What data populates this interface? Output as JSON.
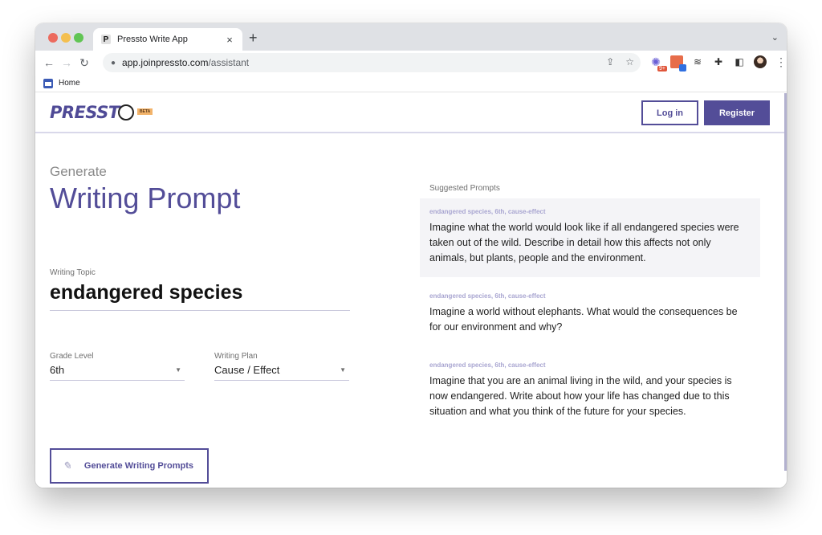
{
  "browser": {
    "tab_title": "Pressto Write App",
    "favicon_glyph": "P",
    "close_icon": "×",
    "new_tab_icon": "+",
    "tab_menu_icon": "⌄",
    "back_icon": "←",
    "forward_icon": "→",
    "reload_icon": "↻",
    "lock_icon": "🔒",
    "url_host": "app.joinpressto.com",
    "url_path": "/assistant",
    "share_icon": "⇪",
    "star_icon": "☆",
    "extension_badge": "9+",
    "layers_icon": "≋",
    "puzzle_icon": "✚",
    "sidepanel_icon": "◧",
    "kebab_icon": "⋮",
    "bookmarks": [
      {
        "label": "Home"
      }
    ]
  },
  "header": {
    "logo_text": "PRESST",
    "beta_label": "BETA",
    "login_label": "Log in",
    "register_label": "Register"
  },
  "form": {
    "eyebrow": "Generate",
    "title": "Writing Prompt",
    "topic_label": "Writing Topic",
    "topic_value": "endangered species",
    "grade_label": "Grade Level",
    "grade_value": "6th",
    "plan_label": "Writing Plan",
    "plan_value": "Cause / Effect",
    "caret_icon": "▼",
    "generate_label": "Generate Writing Prompts",
    "feather_icon": "✎"
  },
  "suggestions": {
    "heading": "Suggested Prompts",
    "items": [
      {
        "tags": "endangered species, 6th, cause-effect",
        "text": "Imagine what the world would look like if all endangered species were taken out of the wild. Describe in detail how this affects not only animals, but plants, people and the environment."
      },
      {
        "tags": "endangered species, 6th, cause-effect",
        "text": "Imagine a world without elephants. What would the consequences be for our environment and why?"
      },
      {
        "tags": "endangered species, 6th, cause-effect",
        "text": "Imagine that you are an animal living in the wild, and your species is now endangered. Write about how your life has changed due to this situation and what you think of the future for your species."
      }
    ]
  },
  "colors": {
    "brand": "#534d98",
    "tag": "#a9a6d1",
    "active_bg": "#f4f4f7"
  }
}
